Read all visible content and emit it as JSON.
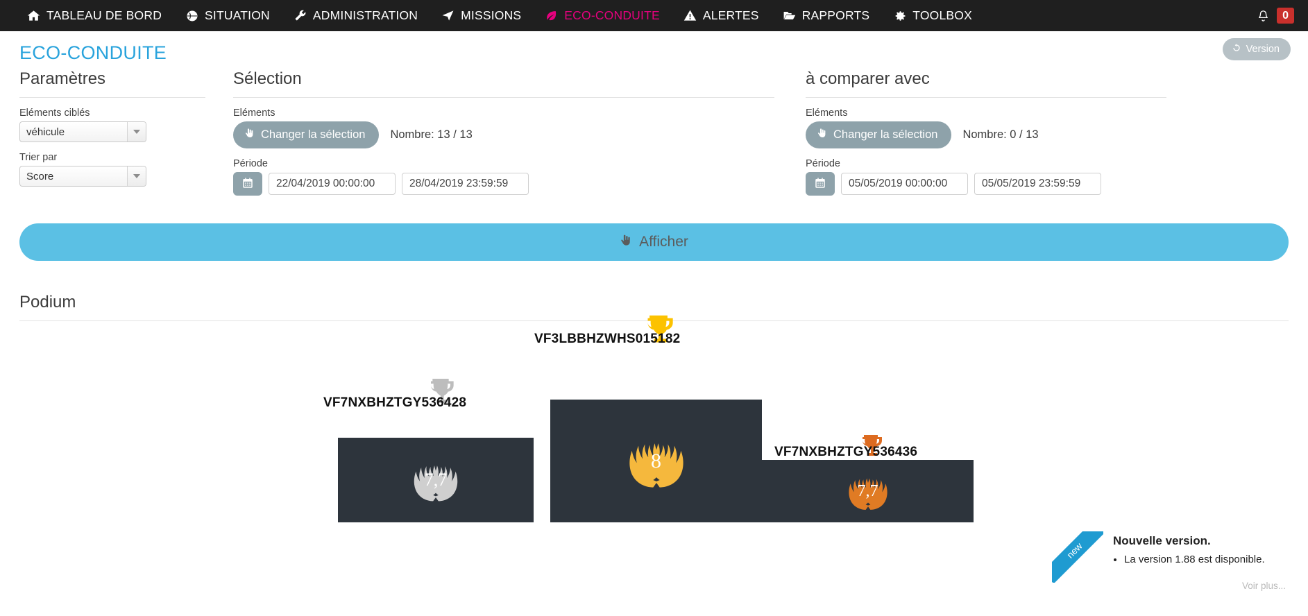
{
  "topnav": {
    "items": [
      {
        "label": "TABLEAU DE BORD",
        "icon": "home-icon",
        "active": false
      },
      {
        "label": "SITUATION",
        "icon": "globe-icon",
        "active": false
      },
      {
        "label": "ADMINISTRATION",
        "icon": "wrench-icon",
        "active": false
      },
      {
        "label": "MISSIONS",
        "icon": "paper-plane-icon",
        "active": false
      },
      {
        "label": "ECO-CONDUITE",
        "icon": "leaf-icon",
        "active": true
      },
      {
        "label": "ALERTES",
        "icon": "warning-triangle-icon",
        "active": false
      },
      {
        "label": "RAPPORTS",
        "icon": "folder-open-icon",
        "active": false
      },
      {
        "label": "TOOLBOX",
        "icon": "gear-icon",
        "active": false
      }
    ],
    "notification_count": "0",
    "active_color": "#e6007e",
    "bar_color": "#1f1f1f",
    "badge_color": "#c9302c"
  },
  "page": {
    "title": "ECO-CONDUITE",
    "title_color": "#29a3dc",
    "version_button": "Version"
  },
  "params": {
    "heading": "Paramètres",
    "targets_label": "Eléments ciblés",
    "targets_value": "véhicule",
    "sort_label": "Trier par",
    "sort_value": "Score"
  },
  "selection": {
    "heading": "Sélection",
    "elements_label": "Eléments",
    "change_button": "Changer la sélection",
    "count": "Nombre: 13 / 13",
    "period_label": "Période",
    "date_start": "22/04/2019 00:00:00",
    "date_end": "28/04/2019 23:59:59"
  },
  "compare": {
    "heading": "à comparer avec",
    "elements_label": "Eléments",
    "change_button": "Changer la sélection",
    "count": "Nombre: 0 / 13",
    "period_label": "Période",
    "date_start": "05/05/2019 00:00:00",
    "date_end": "05/05/2019 23:59:59"
  },
  "actions": {
    "show_button": "Afficher",
    "show_button_color": "#5bc0e4"
  },
  "podium": {
    "heading": "Podium",
    "block_color": "#2d343c",
    "places": [
      {
        "rank": "2",
        "vin": "VF7NXBHZTGY536428",
        "score": "7,7",
        "medal_color": "#bdbdbd",
        "trophy_icon": "silver-trophy-icon",
        "wreath_icon": "laurel-wreath-icon"
      },
      {
        "rank": "1",
        "vin": "VF3LBBHZWHS015182",
        "score": "8",
        "medal_color": "#fcc200",
        "trophy_icon": "gold-trophy-icon",
        "wreath_icon": "laurel-wreath-icon"
      },
      {
        "rank": "3",
        "vin": "VF7NXBHZTGY536436",
        "score": "7,7",
        "medal_color": "#dd6b20",
        "trophy_icon": "bronze-trophy-icon",
        "wreath_icon": "laurel-wreath-icon"
      }
    ]
  },
  "toast": {
    "ribbon": "new",
    "title": "Nouvelle version.",
    "message": "La version 1.88 est disponible.",
    "more": "Voir plus...",
    "ribbon_color": "#1f9bd1"
  }
}
